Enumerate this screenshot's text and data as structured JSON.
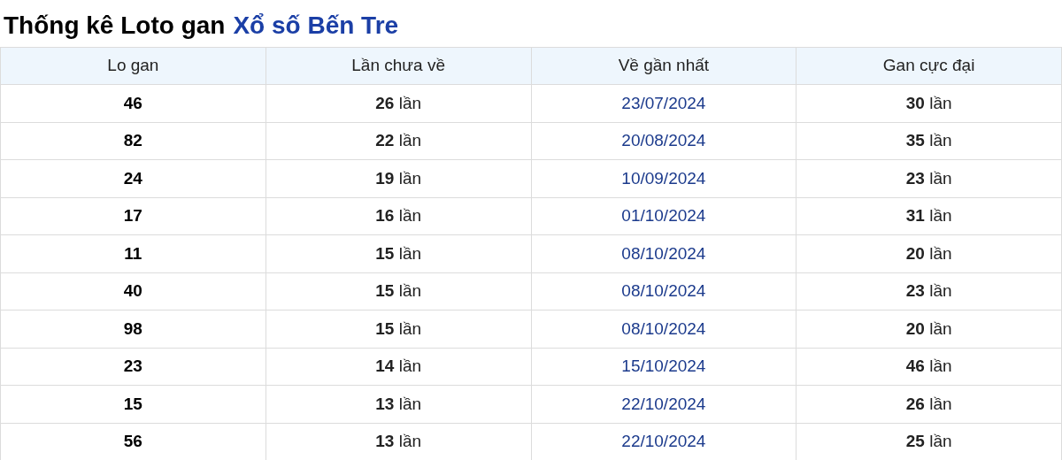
{
  "title": {
    "prefix": "Thống kê Loto gan",
    "highlight": "Xổ số Bến Tre"
  },
  "table": {
    "columns": [
      "Lo gan",
      "Lần chưa về",
      "Về gần nhất",
      "Gan cực đại"
    ],
    "rows": [
      [
        "46",
        "**26** lần",
        "23/07/2024",
        "**30** lần"
      ],
      [
        "82",
        "**22** lần",
        "20/08/2024",
        "**35** lần"
      ],
      [
        "24",
        "**19** lần",
        "10/09/2024",
        "**23** lần"
      ],
      [
        "17",
        "**16** lần",
        "01/10/2024",
        "**31** lần"
      ],
      [
        "11",
        "**15** lần",
        "08/10/2024",
        "**20** lần"
      ],
      [
        "40",
        "**15** lần",
        "08/10/2024",
        "**23** lần"
      ],
      [
        "98",
        "**15** lần",
        "08/10/2024",
        "**20** lần"
      ],
      [
        "23",
        "**14** lần",
        "15/10/2024",
        "**46** lần"
      ],
      [
        "15",
        "**13** lần",
        "22/10/2024",
        "**26** lần"
      ],
      [
        "56",
        "**13** lần",
        "22/10/2024",
        "**25** lần"
      ]
    ]
  }
}
